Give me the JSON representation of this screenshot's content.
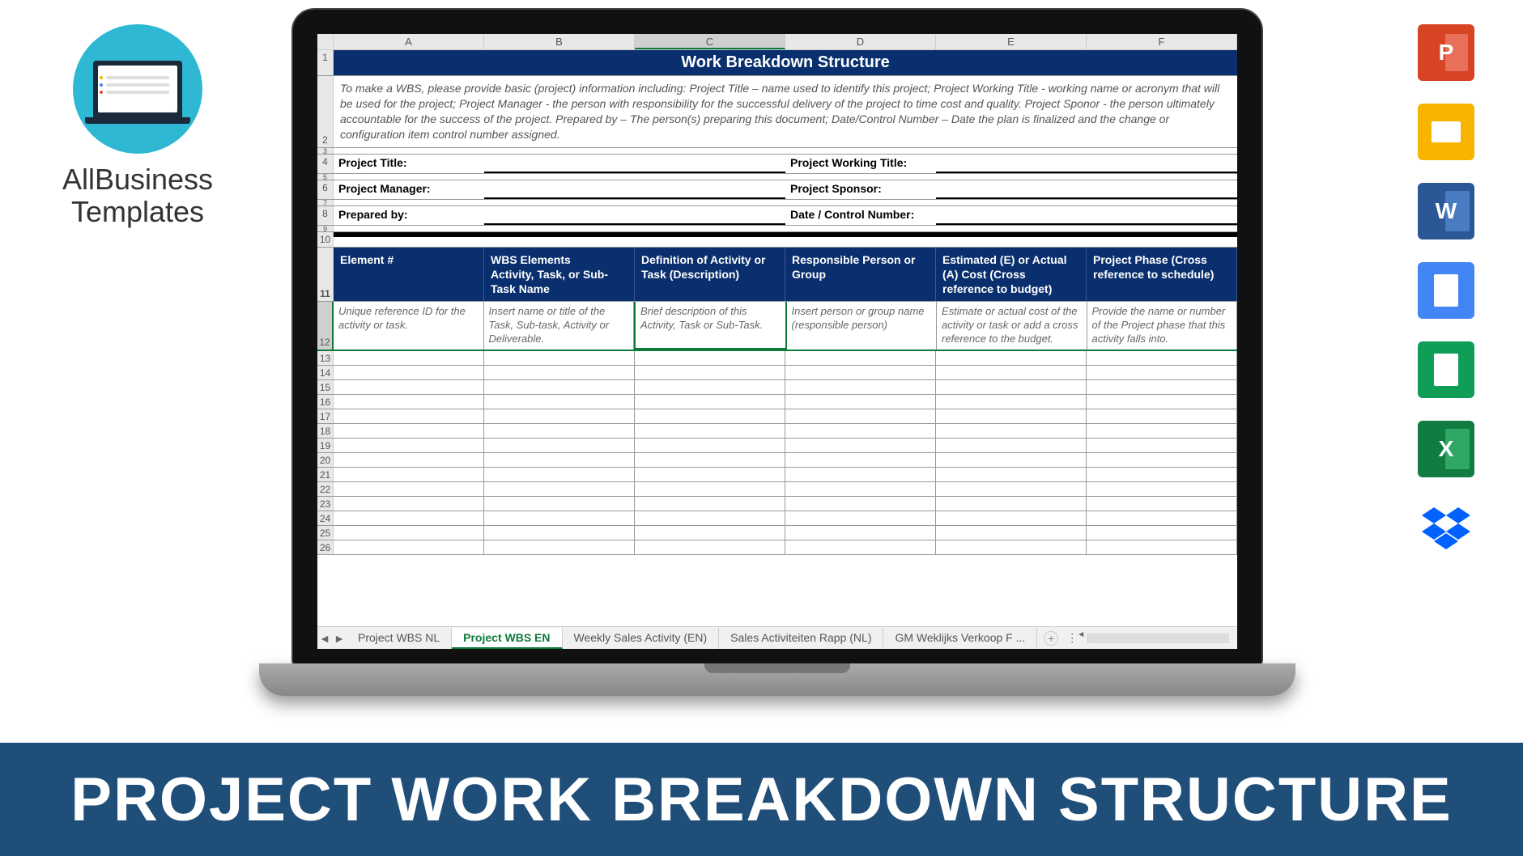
{
  "brand": {
    "line1": "AllBusiness",
    "line2": "Templates"
  },
  "banner": "PROJECT WORK BREAKDOWN STRUCTURE",
  "columns": [
    "A",
    "B",
    "C",
    "D",
    "E",
    "F"
  ],
  "selected_column_index": 2,
  "title": "Work Breakdown Structure",
  "description": "To make a WBS, please provide basic (project) information including: Project Title – name used to identify this project; Project Working Title - working name or acronym that will be used for the project; Project Manager - the person with responsibility for the successful delivery of the project to time cost and quality. Project Sponor - the person ultimately accountable for the success of the project. Prepared by – The person(s) preparing this document; Date/Control Number – Date the plan is finalized and the change or configuration item control number assigned.",
  "fields": {
    "left": [
      "Project Title:",
      "Project Manager:",
      "Prepared by:"
    ],
    "right": [
      "Project Working Title:",
      "Project Sponsor:",
      "Date / Control Number:"
    ]
  },
  "table_headers": [
    "Element #",
    "WBS Elements\nActivity, Task, or Sub-Task Name",
    "Definition of Activity or Task (Description)",
    "Responsible Person or Group",
    "Estimated (E) or Actual (A) Cost (Cross reference to budget)",
    "Project Phase (Cross reference to schedule)"
  ],
  "table_hints": [
    "Unique reference ID for the activity or task.",
    "Insert name or title of the Task, Sub-task, Activity or Deliverable.",
    "Brief description of this Activity, Task or Sub-Task.",
    "Insert person or group name (responsible person)",
    "Estimate or actual cost of the activity or task or add a cross reference to the budget.",
    "Provide the name or number of the Project phase that this activity falls into."
  ],
  "empty_rows": [
    13,
    14,
    15,
    16,
    17,
    18,
    19,
    20,
    21,
    22,
    23,
    24,
    25,
    26
  ],
  "tabs": [
    "Project WBS NL",
    "Project WBS EN",
    "Weekly Sales Activity (EN)",
    "Sales Activiteiten Rapp (NL)",
    "GM Weklijks Verkoop F ..."
  ],
  "active_tab_index": 1,
  "icons": [
    "powerpoint",
    "slides",
    "word",
    "docs",
    "sheets",
    "excel",
    "dropbox"
  ]
}
